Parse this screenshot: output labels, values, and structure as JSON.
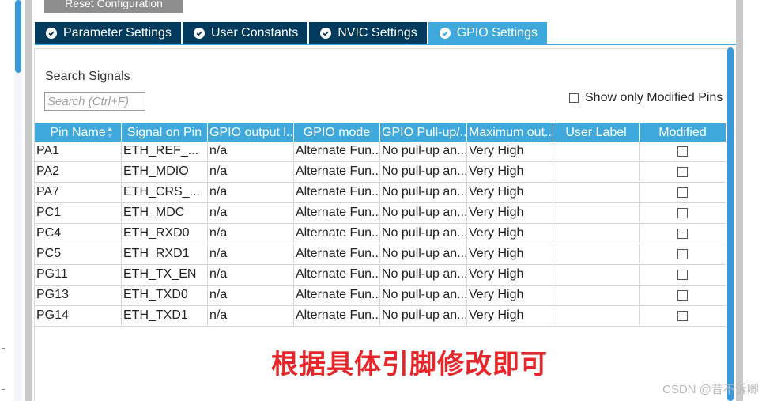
{
  "toolbar": {
    "reset_label": "Reset Configuration"
  },
  "tabs": [
    {
      "label": "Parameter Settings",
      "active": false
    },
    {
      "label": "User Constants",
      "active": false
    },
    {
      "label": "NVIC Settings",
      "active": false
    },
    {
      "label": "GPIO Settings",
      "active": true
    }
  ],
  "search": {
    "label": "Search Signals",
    "placeholder": "Search (Ctrl+F)"
  },
  "filter": {
    "show_modified_label": "Show only Modified Pins",
    "checked": false
  },
  "table": {
    "headers": [
      "Pin Name",
      "Signal on Pin",
      "GPIO output l...",
      "GPIO mode",
      "GPIO Pull-up/...",
      "Maximum out...",
      "User Label",
      "Modified"
    ],
    "rows": [
      [
        "PA1",
        "ETH_REF_...",
        "n/a",
        "Alternate Fun...",
        "No pull-up an...",
        "Very High",
        "",
        ""
      ],
      [
        "PA2",
        "ETH_MDIO",
        "n/a",
        "Alternate Fun...",
        "No pull-up an...",
        "Very High",
        "",
        ""
      ],
      [
        "PA7",
        "ETH_CRS_...",
        "n/a",
        "Alternate Fun...",
        "No pull-up an...",
        "Very High",
        "",
        ""
      ],
      [
        "PC1",
        "ETH_MDC",
        "n/a",
        "Alternate Fun...",
        "No pull-up an...",
        "Very High",
        "",
        ""
      ],
      [
        "PC4",
        "ETH_RXD0",
        "n/a",
        "Alternate Fun...",
        "No pull-up an...",
        "Very High",
        "",
        ""
      ],
      [
        "PC5",
        "ETH_RXD1",
        "n/a",
        "Alternate Fun...",
        "No pull-up an...",
        "Very High",
        "",
        ""
      ],
      [
        "PG11",
        "ETH_TX_EN",
        "n/a",
        "Alternate Fun...",
        "No pull-up an...",
        "Very High",
        "",
        ""
      ],
      [
        "PG13",
        "ETH_TXD0",
        "n/a",
        "Alternate Fun...",
        "No pull-up an...",
        "Very High",
        "",
        ""
      ],
      [
        "PG14",
        "ETH_TXD1",
        "n/a",
        "Alternate Fun...",
        "No pull-up an...",
        "Very High",
        "",
        ""
      ]
    ]
  },
  "annotation": "根据具体引脚修改即可",
  "watermark": "CSDN @昔不诉卿",
  "colors": {
    "tab_dark": "#003a5d",
    "tab_active": "#3fa9dd",
    "header": "#3fa9dd",
    "annotation": "#e8262a"
  }
}
